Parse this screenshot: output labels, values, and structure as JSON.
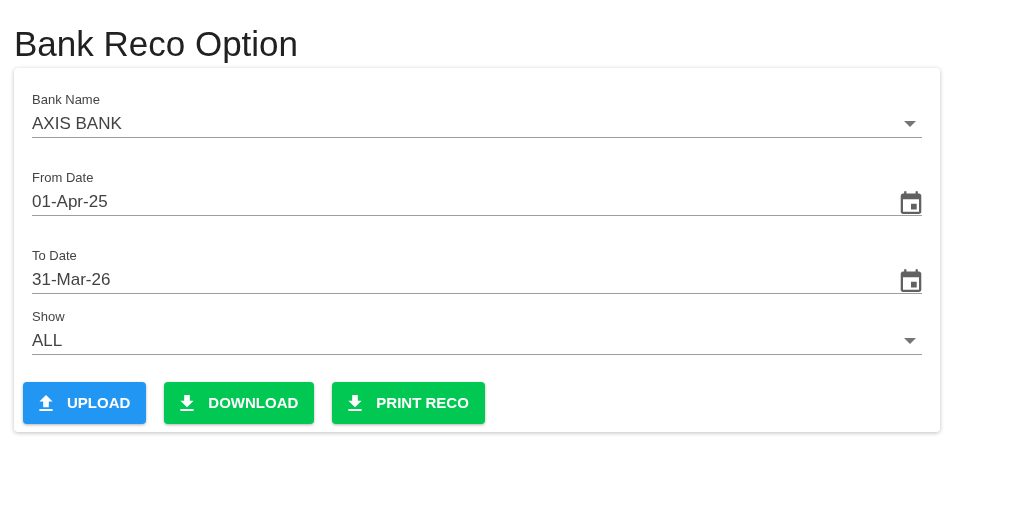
{
  "title": "Bank Reco Option",
  "fields": [
    {
      "kind": "select",
      "label": "Bank Name",
      "value": "AXIS BANK"
    },
    {
      "kind": "date",
      "label": "From Date",
      "value": "01-Apr-25"
    },
    {
      "kind": "date",
      "label": "To Date",
      "value": "31-Mar-26"
    },
    {
      "kind": "select",
      "label": "Show",
      "value": "ALL"
    }
  ],
  "buttons": [
    {
      "kind": "upload",
      "label": "UPLOAD",
      "color": "#2196f3"
    },
    {
      "kind": "download",
      "label": "DOWNLOAD",
      "color": "#00c853"
    },
    {
      "kind": "download",
      "label": "PRINT RECO",
      "color": "#00c853"
    }
  ]
}
